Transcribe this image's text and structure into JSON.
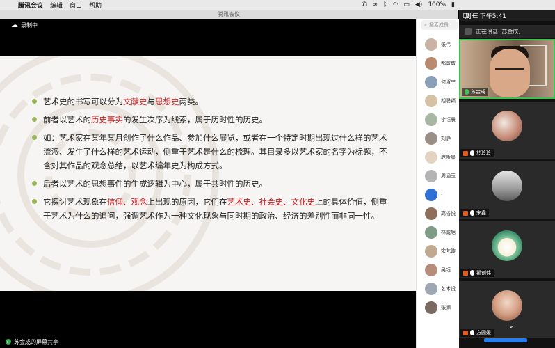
{
  "menubar": {
    "app": "腾讯会议",
    "items": [
      "编辑",
      "窗口",
      "帮助"
    ],
    "battery": "100%",
    "clock": "周一 下午5:41"
  },
  "window": {
    "title": "腾讯会议"
  },
  "recording": {
    "label": "录制中"
  },
  "slide": {
    "b1": {
      "pre": "艺术史的书写可以分为",
      "h1": "文献史",
      "mid": "与",
      "h2": "思想史",
      "post": "两类。"
    },
    "b2": {
      "pre": "前者以艺术的",
      "h1": "历史事实",
      "post": "的发生次序为线索，属于历时性的历史。"
    },
    "b3": "如：艺术家在某年某月创作了什么作品、参加什么展览，或者在一个特定时期出现过什么样的艺术流派、发生了什么样的艺术运动，侧重于艺术是什么的梳理。其目录多以艺术家的名字为标题，不含对其作品的观念总结，以艺术编年史为构成方式。",
    "b4": "后者以艺术的思想事件的生成逻辑为中心，属于共时性的历史。",
    "b5": {
      "pre": "它探讨艺术现象在",
      "h1": "信仰、观念",
      "mid": "上出现的原因，它们在",
      "h2": "艺术史、社会史、文化史",
      "post": "上的具体价值，侧重于艺术为什么的追问，强调艺术作为一种文化现象与同时期的政治、经济的差别性而非同一性。"
    }
  },
  "share": {
    "label": "苏金成的屏幕共享"
  },
  "members": {
    "search_placeholder": "搜索成员",
    "list": [
      "张伟",
      "都敏敏",
      "何淑宁",
      "胡聪颖",
      "李钰晨",
      "刘静",
      "庞听晨",
      "周涵玉",
      "·",
      "高俗悦",
      "林威旭",
      "宋艺璇",
      "吴钰",
      "艺术设",
      "张源"
    ]
  },
  "video": {
    "speaking": "正在讲话: 苏金成;",
    "tiles": [
      {
        "name": "苏金成"
      },
      {
        "name": "於玲玲"
      },
      {
        "name": "宋鑫"
      },
      {
        "name": "翟创伟"
      },
      {
        "name": "方圆媛"
      }
    ]
  }
}
